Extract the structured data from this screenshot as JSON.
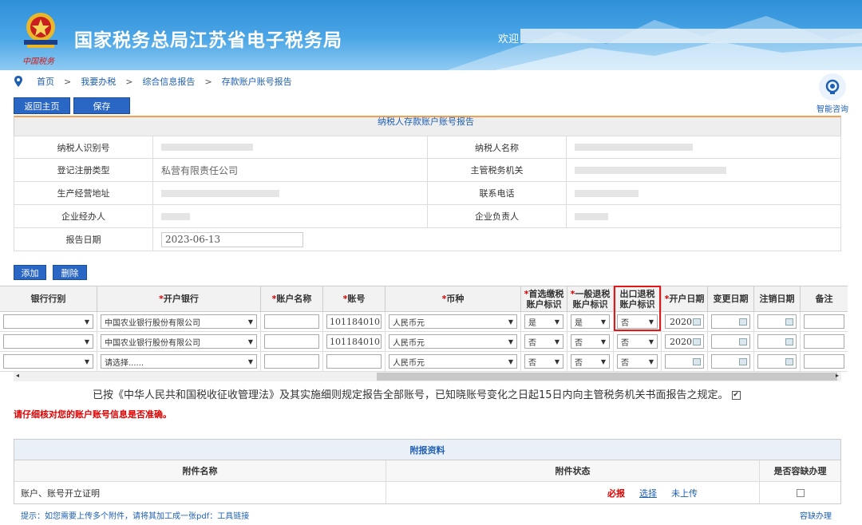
{
  "header": {
    "site_title": "国家税务总局江苏省电子税务局",
    "welcome": "欢迎",
    "logo_caption": "中国税务"
  },
  "breadcrumb": [
    "首页",
    "我要办税",
    "综合信息报告",
    "存款账户账号报告"
  ],
  "assistant_label": "智能咨询",
  "toolbar": {
    "back_label": "返回主页",
    "save_label": "保存"
  },
  "report_section_title": "纳税人存款账户账号报告",
  "taxpayer_info": {
    "rows": [
      {
        "l1": "纳税人识别号",
        "v1": "",
        "l2": "纳税人名称",
        "v2": ""
      },
      {
        "l1": "登记注册类型",
        "v1": "私营有限责任公司",
        "l2": "主管税务机关",
        "v2": ""
      },
      {
        "l1": "生产经营地址",
        "v1": "",
        "l2": "联系电话",
        "v2": ""
      },
      {
        "l1": "企业经办人",
        "v1": "",
        "l2": "企业负责人",
        "v2": ""
      }
    ],
    "report_date_label": "报告日期",
    "report_date": "2023-06-13"
  },
  "accounts_toolbar": {
    "add_label": "添加",
    "delete_label": "删除"
  },
  "accounts_headers": {
    "bank_type": "银行行别",
    "bank": "*开户银行",
    "account_name": "*账户名称",
    "account_no": "*账号",
    "currency": "*币种",
    "first_tax": "*首选缴税账户标识",
    "general_refund": "*一般退税账户标识",
    "export_refund": "出口退税账户标识",
    "open_date": "*开户日期",
    "change_date": "变更日期",
    "cancel_date": "注销日期",
    "remark": "备注"
  },
  "accounts": [
    {
      "bank": "中国农业银行股份有限公司",
      "account_no": "101184010",
      "currency": "人民币元",
      "first_tax": "是",
      "general_refund": "是",
      "export_refund": "否",
      "open_date": "2020"
    },
    {
      "bank": "中国农业银行股份有限公司",
      "account_no": "101184010",
      "currency": "人民币元",
      "first_tax": "否",
      "general_refund": "否",
      "export_refund": "否",
      "open_date": "2020"
    },
    {
      "bank": "请选择......",
      "account_no": "",
      "currency": "人民币元",
      "first_tax": "否",
      "general_refund": "否",
      "export_refund": "否",
      "open_date": ""
    }
  ],
  "statement": "已按《中华人民共和国税收征收管理法》及其实施细则规定报告全部账号，已知晓账号变化之日起15日内向主管税务机关书面报告之规定。",
  "statement_checked": true,
  "warning": "请仔细核对您的账户账号信息是否准确。",
  "attachments": {
    "title": "附报资料",
    "col_name": "附件名称",
    "col_status": "附件状态",
    "col_tolerance": "是否容缺办理",
    "rows": [
      {
        "name": "账户、账号开立证明",
        "required": "必报",
        "select": "选择",
        "status": "未上传"
      }
    ]
  },
  "hint": "提示：如您需要上传多个附件，请将其加工成一张pdf：工具链接",
  "tolerance_link": "容缺办理",
  "colors": {
    "header_blue": "#2f8fd8",
    "button_blue": "#2a66c4",
    "link_blue": "#1e5fb4",
    "warn_red": "#dd0000",
    "highlight_red": "#e01818"
  }
}
